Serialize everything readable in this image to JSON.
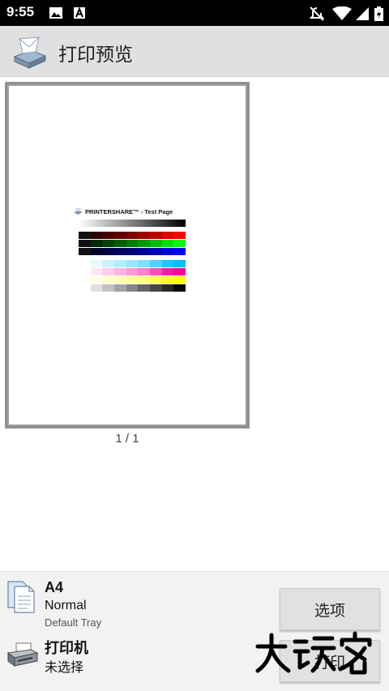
{
  "status_bar": {
    "time": "9:55",
    "icons": [
      "image-icon",
      "a-notification-icon",
      "do-not-disturb-off-icon",
      "wifi-icon",
      "signal-icon",
      "battery-charging-icon"
    ]
  },
  "header": {
    "title": "打印预览",
    "logo_icon": "printershare-logo-icon"
  },
  "preview": {
    "test_page_title": "PRINTERSHARE™ - Test Page",
    "page_indicator": "1 / 1"
  },
  "settings": {
    "paper_size": "A4",
    "paper_type": "Normal",
    "paper_tray": "Default Tray",
    "printer_label": "打印机",
    "printer_status": "未选择"
  },
  "buttons": {
    "options_label": "选项",
    "print_label": "打印"
  },
  "watermark": "大玩家"
}
